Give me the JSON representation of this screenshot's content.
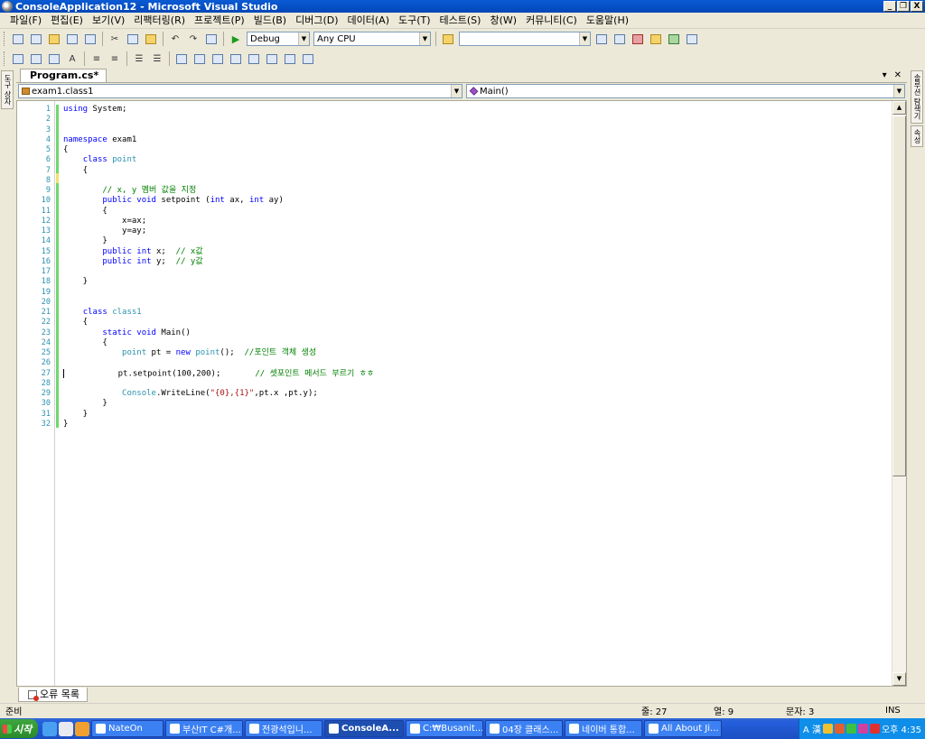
{
  "window": {
    "title": "ConsoleApplication12 - Microsoft Visual Studio",
    "controls": [
      "_",
      "❐",
      "X"
    ]
  },
  "menu": [
    "파일(F)",
    "편집(E)",
    "보기(V)",
    "리팩터링(R)",
    "프로젝트(P)",
    "빌드(B)",
    "디버그(D)",
    "데이터(A)",
    "도구(T)",
    "테스트(S)",
    "창(W)",
    "커뮤니티(C)",
    "도움말(H)"
  ],
  "toolbar": {
    "config": "Debug",
    "platform": "Any CPU",
    "find_value": ""
  },
  "document_tab": {
    "label": "Program.cs*",
    "menu_glyph": "▾",
    "close_glyph": "✕"
  },
  "navigation": {
    "types": "exam1.class1",
    "members": "Main()"
  },
  "editor": {
    "line_numbers": [
      "1",
      "2",
      "3",
      "4",
      "5",
      "6",
      "7",
      "8",
      "9",
      "10",
      "11",
      "12",
      "13",
      "14",
      "15",
      "16",
      "17",
      "18",
      "19",
      "20",
      "21",
      "22",
      "23",
      "24",
      "25",
      "26",
      "27",
      "28",
      "29",
      "30",
      "31",
      "32"
    ],
    "lines": [
      [
        {
          "t": "kw",
          "v": "using"
        },
        {
          "t": "",
          "v": " System;"
        }
      ],
      [],
      [],
      [
        {
          "t": "kw",
          "v": "namespace"
        },
        {
          "t": "",
          "v": " exam1"
        }
      ],
      [
        {
          "t": "",
          "v": "{"
        }
      ],
      [
        {
          "t": "",
          "v": "    "
        },
        {
          "t": "kw",
          "v": "class"
        },
        {
          "t": "",
          "v": " "
        },
        {
          "t": "ty",
          "v": "point"
        }
      ],
      [
        {
          "t": "",
          "v": "    {"
        }
      ],
      [],
      [
        {
          "t": "",
          "v": "        "
        },
        {
          "t": "cm",
          "v": "// x, y 멤버 값을 지정"
        }
      ],
      [
        {
          "t": "",
          "v": "        "
        },
        {
          "t": "kw",
          "v": "public"
        },
        {
          "t": "",
          "v": " "
        },
        {
          "t": "kw",
          "v": "void"
        },
        {
          "t": "",
          "v": " setpoint ("
        },
        {
          "t": "kw",
          "v": "int"
        },
        {
          "t": "",
          "v": " ax, "
        },
        {
          "t": "kw",
          "v": "int"
        },
        {
          "t": "",
          "v": " ay)"
        }
      ],
      [
        {
          "t": "",
          "v": "        {"
        }
      ],
      [
        {
          "t": "",
          "v": "            x=ax;"
        }
      ],
      [
        {
          "t": "",
          "v": "            y=ay;"
        }
      ],
      [
        {
          "t": "",
          "v": "        }"
        }
      ],
      [
        {
          "t": "",
          "v": "        "
        },
        {
          "t": "kw",
          "v": "public"
        },
        {
          "t": "",
          "v": " "
        },
        {
          "t": "kw",
          "v": "int"
        },
        {
          "t": "",
          "v": " x;  "
        },
        {
          "t": "cm",
          "v": "// x값"
        }
      ],
      [
        {
          "t": "",
          "v": "        "
        },
        {
          "t": "kw",
          "v": "public"
        },
        {
          "t": "",
          "v": " "
        },
        {
          "t": "kw",
          "v": "int"
        },
        {
          "t": "",
          "v": " y;  "
        },
        {
          "t": "cm",
          "v": "// y값"
        }
      ],
      [],
      [
        {
          "t": "",
          "v": "    }"
        }
      ],
      [],
      [],
      [
        {
          "t": "",
          "v": "    "
        },
        {
          "t": "kw",
          "v": "class"
        },
        {
          "t": "",
          "v": " "
        },
        {
          "t": "ty",
          "v": "class1"
        }
      ],
      [
        {
          "t": "",
          "v": "    {"
        }
      ],
      [
        {
          "t": "",
          "v": "        "
        },
        {
          "t": "kw",
          "v": "static"
        },
        {
          "t": "",
          "v": " "
        },
        {
          "t": "kw",
          "v": "void"
        },
        {
          "t": "",
          "v": " Main()"
        }
      ],
      [
        {
          "t": "",
          "v": "        {"
        }
      ],
      [
        {
          "t": "",
          "v": "            "
        },
        {
          "t": "ty",
          "v": "point"
        },
        {
          "t": "",
          "v": " pt = "
        },
        {
          "t": "kw",
          "v": "new"
        },
        {
          "t": "",
          "v": " "
        },
        {
          "t": "ty",
          "v": "point"
        },
        {
          "t": "",
          "v": "();  "
        },
        {
          "t": "cm",
          "v": "//포인트 객체 생성"
        }
      ],
      [],
      [
        {
          "t": "caret",
          "v": ""
        },
        {
          "t": "",
          "v": "           pt.setpoint(100,200);       "
        },
        {
          "t": "cm",
          "v": "// 셋포인트 메서드 부르기 ㅎㅎ"
        }
      ],
      [],
      [
        {
          "t": "",
          "v": "            "
        },
        {
          "t": "ty",
          "v": "Console"
        },
        {
          "t": "",
          "v": ".WriteLine("
        },
        {
          "t": "st",
          "v": "\"{0},{1}\""
        },
        {
          "t": "",
          "v": ",pt.x ,pt.y);"
        }
      ],
      [
        {
          "t": "",
          "v": "        }"
        }
      ],
      [
        {
          "t": "",
          "v": "    }"
        }
      ],
      [
        {
          "t": "",
          "v": "}"
        }
      ]
    ]
  },
  "left_tabs": [
    "도구 상자"
  ],
  "right_tabs": [
    "솔루션 탐색기",
    "속성"
  ],
  "error_list": {
    "label": "오류 목록"
  },
  "status": {
    "ready": "준비",
    "line": "줄: 27",
    "col": "열: 9",
    "chars": "문자: 3",
    "mode": "INS"
  },
  "taskbar": {
    "start": "시작",
    "tasks": [
      {
        "label": "NateOn",
        "active": false
      },
      {
        "label": "부산IT C#개...",
        "active": false
      },
      {
        "label": "전광석입니...",
        "active": false
      },
      {
        "label": "ConsoleA...",
        "active": true
      },
      {
        "label": "C:₩Busanit...",
        "active": false
      },
      {
        "label": "04장 클래스...",
        "active": false
      },
      {
        "label": "네이버 통합...",
        "active": false
      },
      {
        "label": "All About Ji...",
        "active": false
      }
    ],
    "ime": "A 漢",
    "clock": "오후 4:35"
  },
  "colors": {
    "keyword": "#0000ff",
    "type": "#2b91af",
    "comment": "#008000",
    "string": "#a31515",
    "title_bar": "#0a5bd4",
    "taskbar": "#245edb"
  }
}
